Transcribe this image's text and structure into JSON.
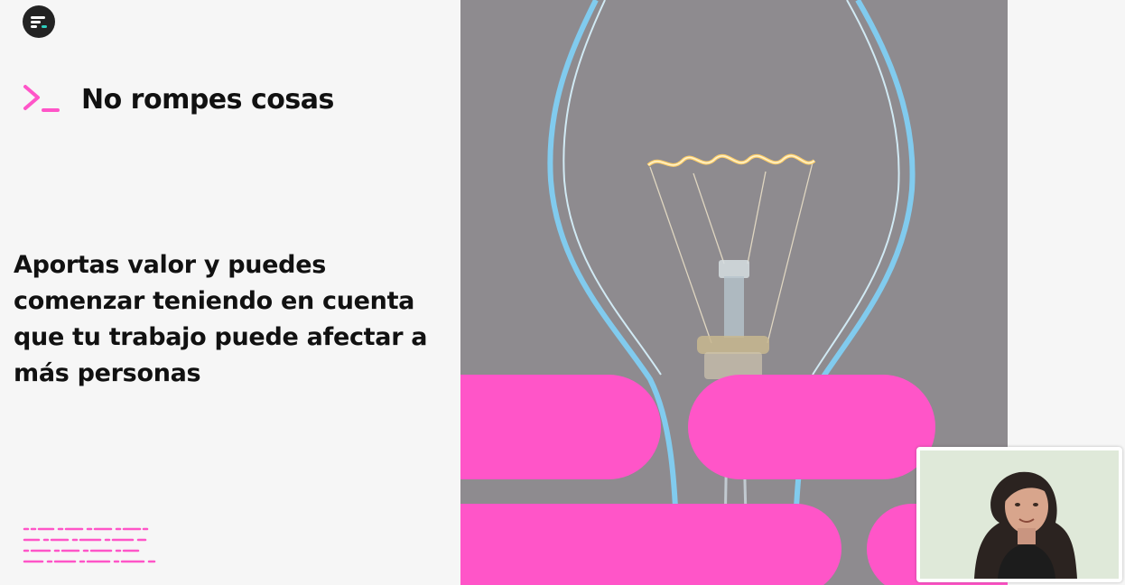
{
  "slide": {
    "title": "No rompes cosas",
    "body": "Aportas valor y puedes comenzar teniendo en cuenta que tu trabajo puede afectar a más personas"
  },
  "icons": {
    "logo": "platform-logo-icon",
    "prompt": "terminal-prompt-icon",
    "pattern": "dashed-lines-decoration"
  },
  "colors": {
    "accent": "#ff55c8",
    "text": "#111111",
    "photo_bg": "#8e8b8f",
    "bulb_glow": "#aee4ff",
    "filament": "#ffcf6a",
    "webcam_bg": "#dfe9d9"
  }
}
